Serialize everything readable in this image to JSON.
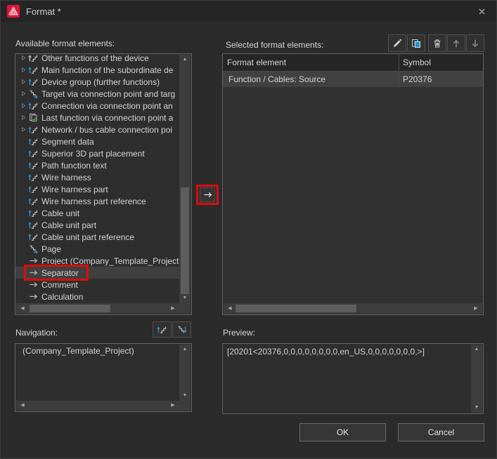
{
  "window": {
    "title": "Format *"
  },
  "available": {
    "label": "Available format elements:",
    "items": [
      {
        "label": "Other functions of the device",
        "icon": "stairs-up-gray",
        "expander": true
      },
      {
        "label": "Main function of the subordinate de",
        "icon": "stairs-up-blue",
        "expander": true
      },
      {
        "label": "Device group (further functions)",
        "icon": "stairs-up-blue",
        "expander": true
      },
      {
        "label": "Target via connection point and targ",
        "icon": "stairs-right-blue",
        "expander": true
      },
      {
        "label": "Connection via connection point an",
        "icon": "stairs-up-blue",
        "expander": true
      },
      {
        "label": "Last function via connection point a",
        "icon": "copy-check",
        "expander": true
      },
      {
        "label": "Network / bus cable connection poi",
        "icon": "stairs-up-blue",
        "expander": true
      },
      {
        "label": "Segment data",
        "icon": "stairs-up-blue",
        "expander": false
      },
      {
        "label": "Superior 3D part placement",
        "icon": "stairs-up-blue",
        "expander": false
      },
      {
        "label": "Path function text",
        "icon": "stairs-up-blue",
        "expander": false
      },
      {
        "label": "Wire harness",
        "icon": "stairs-up-blue",
        "expander": false
      },
      {
        "label": "Wire harness part",
        "icon": "stairs-up-blue",
        "expander": false
      },
      {
        "label": "Wire harness part reference",
        "icon": "stairs-up-blue",
        "expander": false
      },
      {
        "label": "Cable unit",
        "icon": "stairs-up-blue",
        "expander": false
      },
      {
        "label": "Cable unit part",
        "icon": "stairs-up-blue",
        "expander": false
      },
      {
        "label": "Cable unit part reference",
        "icon": "stairs-up-blue",
        "expander": false
      },
      {
        "label": "Page",
        "icon": "stairs-right-blue",
        "expander": false
      },
      {
        "label": "Project (Company_Template_Project",
        "icon": "arrow-right-gray",
        "expander": false
      },
      {
        "label": "Separator",
        "icon": "arrow-right-gray",
        "expander": false,
        "selected": true,
        "annotated": true
      },
      {
        "label": "Comment",
        "icon": "arrow-right-gray",
        "expander": false
      },
      {
        "label": "Calculation",
        "icon": "arrow-right-gray",
        "expander": false
      }
    ]
  },
  "selected_panel": {
    "label": "Selected format elements:",
    "toolbar": [
      {
        "name": "edit",
        "icon": "pencil-icon"
      },
      {
        "name": "copy",
        "icon": "copy-icon"
      },
      {
        "name": "delete",
        "icon": "trash-icon"
      },
      {
        "name": "move-up",
        "icon": "arrow-up-icon"
      },
      {
        "name": "move-down",
        "icon": "arrow-down-icon"
      }
    ],
    "table": {
      "columns": [
        "Format element",
        "Symbol"
      ],
      "rows": [
        {
          "format_element": "Function / Cables: Source",
          "symbol": "P20376"
        }
      ]
    }
  },
  "navigation": {
    "label": "Navigation:",
    "items": [
      "(Company_Template_Project)"
    ],
    "toolbar": [
      {
        "name": "level-up",
        "icon": "stairs-up-icon"
      },
      {
        "name": "level-down",
        "icon": "stairs-down-icon"
      }
    ]
  },
  "preview": {
    "label": "Preview:",
    "value": "[20201<20376,0,0,0,0,0,0,0,0,en_US,0,0,0,0,0,0,0,>]"
  },
  "actions": {
    "ok": "OK",
    "cancel": "Cancel"
  },
  "glyphs": {
    "scroll_up": "▲",
    "scroll_down": "▼",
    "scroll_left": "◀",
    "scroll_right": "▶"
  },
  "colors": {
    "annotation_red": "#e00b0b",
    "accent_blue": "#2d8ccd",
    "logo_red": "#e0153a",
    "selection_gray": "#404040"
  }
}
